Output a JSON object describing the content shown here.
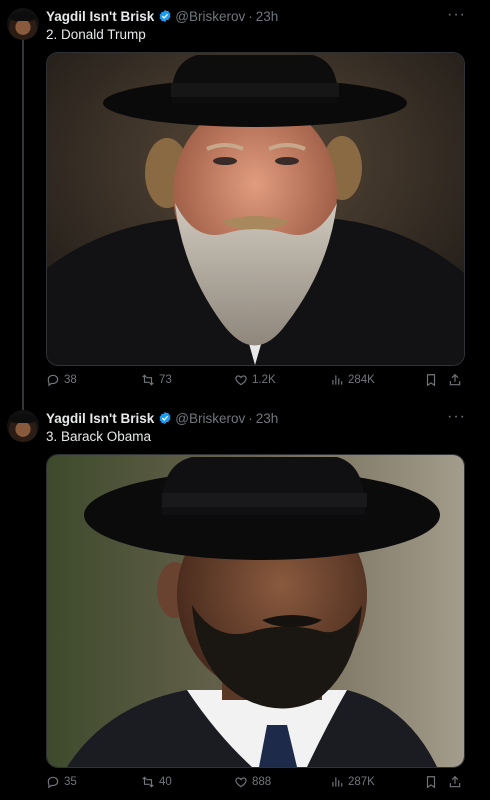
{
  "tweets": [
    {
      "author": {
        "name": "Yagdil Isn't Brisk",
        "handle": "@Briskerov"
      },
      "separator": "·",
      "time": "23h",
      "text": "2. Donald Trump",
      "stats": {
        "replies": "38",
        "reposts": "73",
        "likes": "1.2K",
        "views": "284K"
      }
    },
    {
      "author": {
        "name": "Yagdil Isn't Brisk",
        "handle": "@Briskerov"
      },
      "separator": "·",
      "time": "23h",
      "text": "3. Barack Obama",
      "stats": {
        "replies": "35",
        "reposts": "40",
        "likes": "888",
        "views": "287K"
      }
    }
  ],
  "icons": {
    "verified": "verified-badge-icon",
    "more": "more-icon",
    "reply": "reply-icon",
    "repost": "repost-icon",
    "like": "like-icon",
    "views": "views-icon",
    "bookmark": "bookmark-icon",
    "share": "share-icon"
  },
  "colors": {
    "background": "#000000",
    "text": "#e7e9ea",
    "muted": "#71767b",
    "verified": "#1d9bf0"
  }
}
